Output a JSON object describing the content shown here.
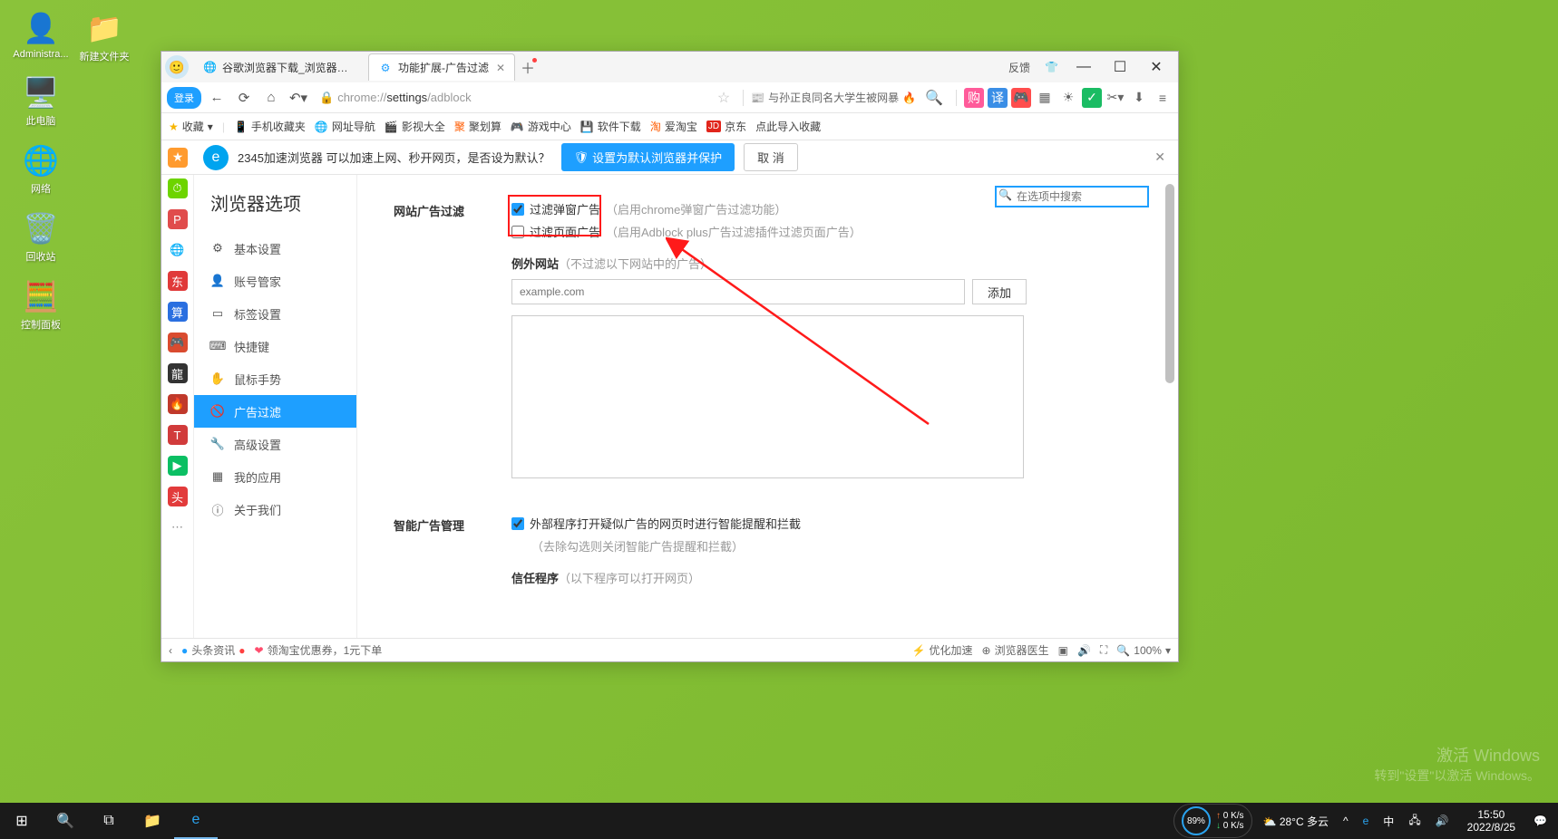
{
  "desktop": {
    "icons_col1": [
      {
        "label": "Administra...",
        "glyph": "👤"
      },
      {
        "label": "此电脑",
        "glyph": "🖥️"
      },
      {
        "label": "网络",
        "glyph": "🖧"
      },
      {
        "label": "回收站",
        "glyph": "🗑️"
      },
      {
        "label": "控制面板",
        "glyph": "🧮"
      }
    ],
    "icons_col2": [
      {
        "label": "新建文件夹",
        "glyph": "📁"
      }
    ]
  },
  "browser": {
    "tabs": [
      {
        "title": "谷歌浏览器下载_浏览器官网入",
        "favicon": "🌐",
        "active": false
      },
      {
        "title": "功能扩展-广告过滤",
        "favicon": "⚙",
        "active": true
      }
    ],
    "feedback": "反馈",
    "login": "登录",
    "url_prefix": "chrome://",
    "url_mid": "settings",
    "url_suffix": "/adblock",
    "hot_search": "与孙正良同名大学生被网暴",
    "bookmarks": {
      "fav": "收藏",
      "items": [
        {
          "ico": "📱",
          "label": "手机收藏夹"
        },
        {
          "ico": "🌐",
          "label": "网址导航"
        },
        {
          "ico": "🎬",
          "label": "影视大全"
        },
        {
          "ico": "🛒",
          "label": "聚划算"
        },
        {
          "ico": "🎮",
          "label": "游戏中心"
        },
        {
          "ico": "💾",
          "label": "软件下载"
        },
        {
          "ico": "🛍️",
          "label": "爱淘宝"
        },
        {
          "ico": "JD",
          "label": "京东"
        },
        {
          "ico": "",
          "label": "点此导入收藏"
        }
      ]
    },
    "banner": {
      "text": "2345加速浏览器 可以加速上网、秒开网页，是否设为默认？",
      "blue_btn": "设置为默认浏览器并保护",
      "cancel": "取 消"
    },
    "rail": [
      {
        "bg": "#ff9b2f",
        "t": "★"
      },
      {
        "bg": "#6dd400",
        "t": "⏱"
      },
      {
        "bg": "#e04c4c",
        "t": "P"
      },
      {
        "bg": "#ffb400",
        "t": "●"
      },
      {
        "bg": "#e03a3a",
        "t": "东"
      },
      {
        "bg": "#2a6fe0",
        "t": "算"
      },
      {
        "bg": "#d94b2f",
        "t": "🎮"
      },
      {
        "bg": "#333",
        "t": "龍"
      },
      {
        "bg": "#c0392b",
        "t": "🔥"
      },
      {
        "bg": "#d13b3b",
        "t": "T"
      },
      {
        "bg": "#0bbf63",
        "t": "▶"
      },
      {
        "bg": "#e23b3b",
        "t": "头"
      },
      {
        "bg": "#888",
        "t": "⋯"
      }
    ],
    "sidebar": {
      "title": "浏览器选项",
      "items": [
        {
          "ico": "⚙",
          "label": "基本设置"
        },
        {
          "ico": "👤",
          "label": "账号管家"
        },
        {
          "ico": "🔖",
          "label": "标签设置"
        },
        {
          "ico": "⌨",
          "label": "快捷键"
        },
        {
          "ico": "✋",
          "label": "鼠标手势"
        },
        {
          "ico": "🚫",
          "label": "广告过滤",
          "active": true
        },
        {
          "ico": "🔧",
          "label": "高级设置"
        },
        {
          "ico": "▦",
          "label": "我的应用"
        },
        {
          "ico": "ⓘ",
          "label": "关于我们"
        }
      ]
    },
    "content": {
      "search_placeholder": "在选项中搜索",
      "sec1_label": "网站广告过滤",
      "chk1": "过滤弹窗广告",
      "chk1_hint": "（启用chrome弹窗广告过滤功能）",
      "chk2": "过滤页面广告",
      "chk2_hint": "（启用Adblock plus广告过滤插件过滤页面广告）",
      "exc_label": "例外网站",
      "exc_hint": "（不过滤以下网站中的广告）",
      "exc_placeholder": "example.com",
      "add_btn": "添加",
      "sec2_label": "智能广告管理",
      "chk3": "外部程序打开疑似广告的网页时进行智能提醒和拦截",
      "chk3_sub": "（去除勾选则关闭智能广告提醒和拦截）",
      "trust_label": "信任程序",
      "trust_hint": "（以下程序可以打开网页）"
    },
    "statusbar": {
      "arrow": "‹",
      "news": "头条资讯",
      "coupon": "领淘宝优惠券，1元下单",
      "opt": "优化加速",
      "doctor": "浏览器医生",
      "zoom": "100%"
    }
  },
  "taskbar": {
    "weather": "28°C 多云",
    "net_pct": "89%",
    "net_up": "0 K/s",
    "net_dn": "0 K/s",
    "time": "15:50",
    "date": "2022/8/25"
  },
  "watermark": {
    "l1": "激活 Windows",
    "l2": "转到\"设置\"以激活 Windows。"
  }
}
